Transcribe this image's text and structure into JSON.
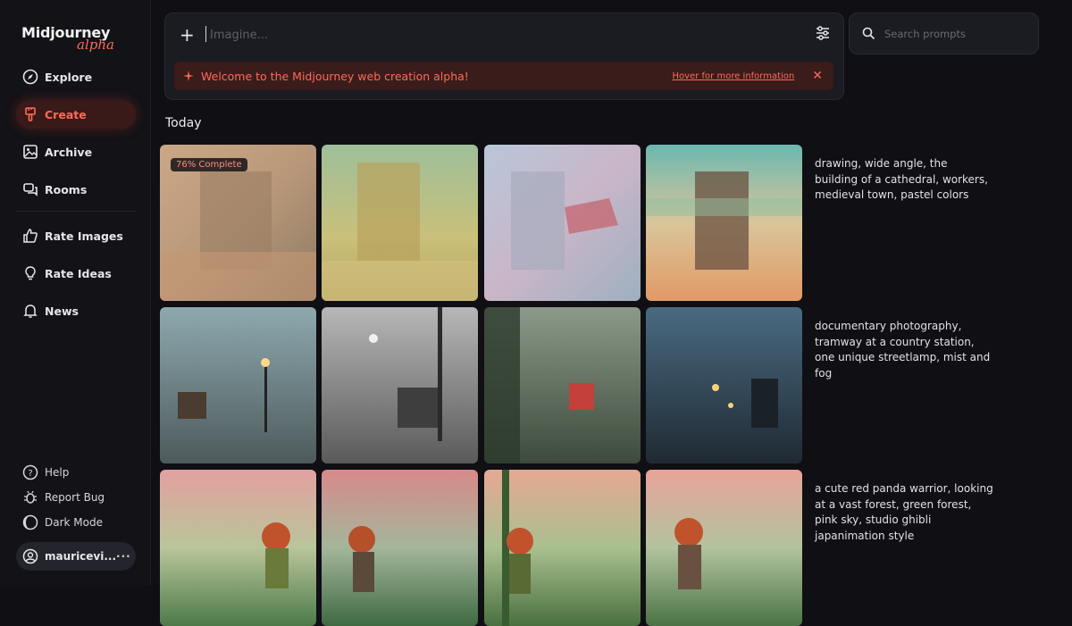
{
  "app": {
    "logo_main": "Midjourney",
    "logo_sub": "alpha"
  },
  "sidebar": {
    "items": [
      {
        "label": "Explore",
        "icon": "compass-icon"
      },
      {
        "label": "Create",
        "icon": "paintbrush-icon",
        "active": true
      },
      {
        "label": "Archive",
        "icon": "image-icon"
      },
      {
        "label": "Rooms",
        "icon": "chat-icon"
      },
      {
        "label": "Rate Images",
        "icon": "thumbs-up-icon"
      },
      {
        "label": "Rate Ideas",
        "icon": "lightbulb-icon"
      },
      {
        "label": "News",
        "icon": "bell-icon"
      }
    ],
    "footer": [
      {
        "label": "Help",
        "icon": "help-icon"
      },
      {
        "label": "Report Bug",
        "icon": "bug-icon"
      },
      {
        "label": "Dark Mode",
        "icon": "moon-icon"
      }
    ],
    "user": {
      "name": "mauricevi...",
      "more": "···"
    }
  },
  "prompt": {
    "placeholder": "Imagine...",
    "banner_text": "Welcome to the Midjourney web creation alpha!",
    "banner_link": "Hover for more information"
  },
  "search": {
    "placeholder": "Search prompts"
  },
  "feed": {
    "section": "Today",
    "rows": [
      {
        "caption": "drawing, wide angle, the building of a cathedral, workers, medieval town, pastel colors",
        "progress_label": "76% Complete",
        "progress": 0.76
      },
      {
        "caption": "documentary photography, tramway at a country station, one unique streetlamp, mist and fog"
      },
      {
        "caption": "a cute red panda warrior, looking at a vast forest, green forest, pink sky, studio ghibli japanimation style"
      }
    ]
  },
  "colors": {
    "accent": "#ff6a5a",
    "background": "#0f0f14",
    "panel": "#1b1b22"
  }
}
